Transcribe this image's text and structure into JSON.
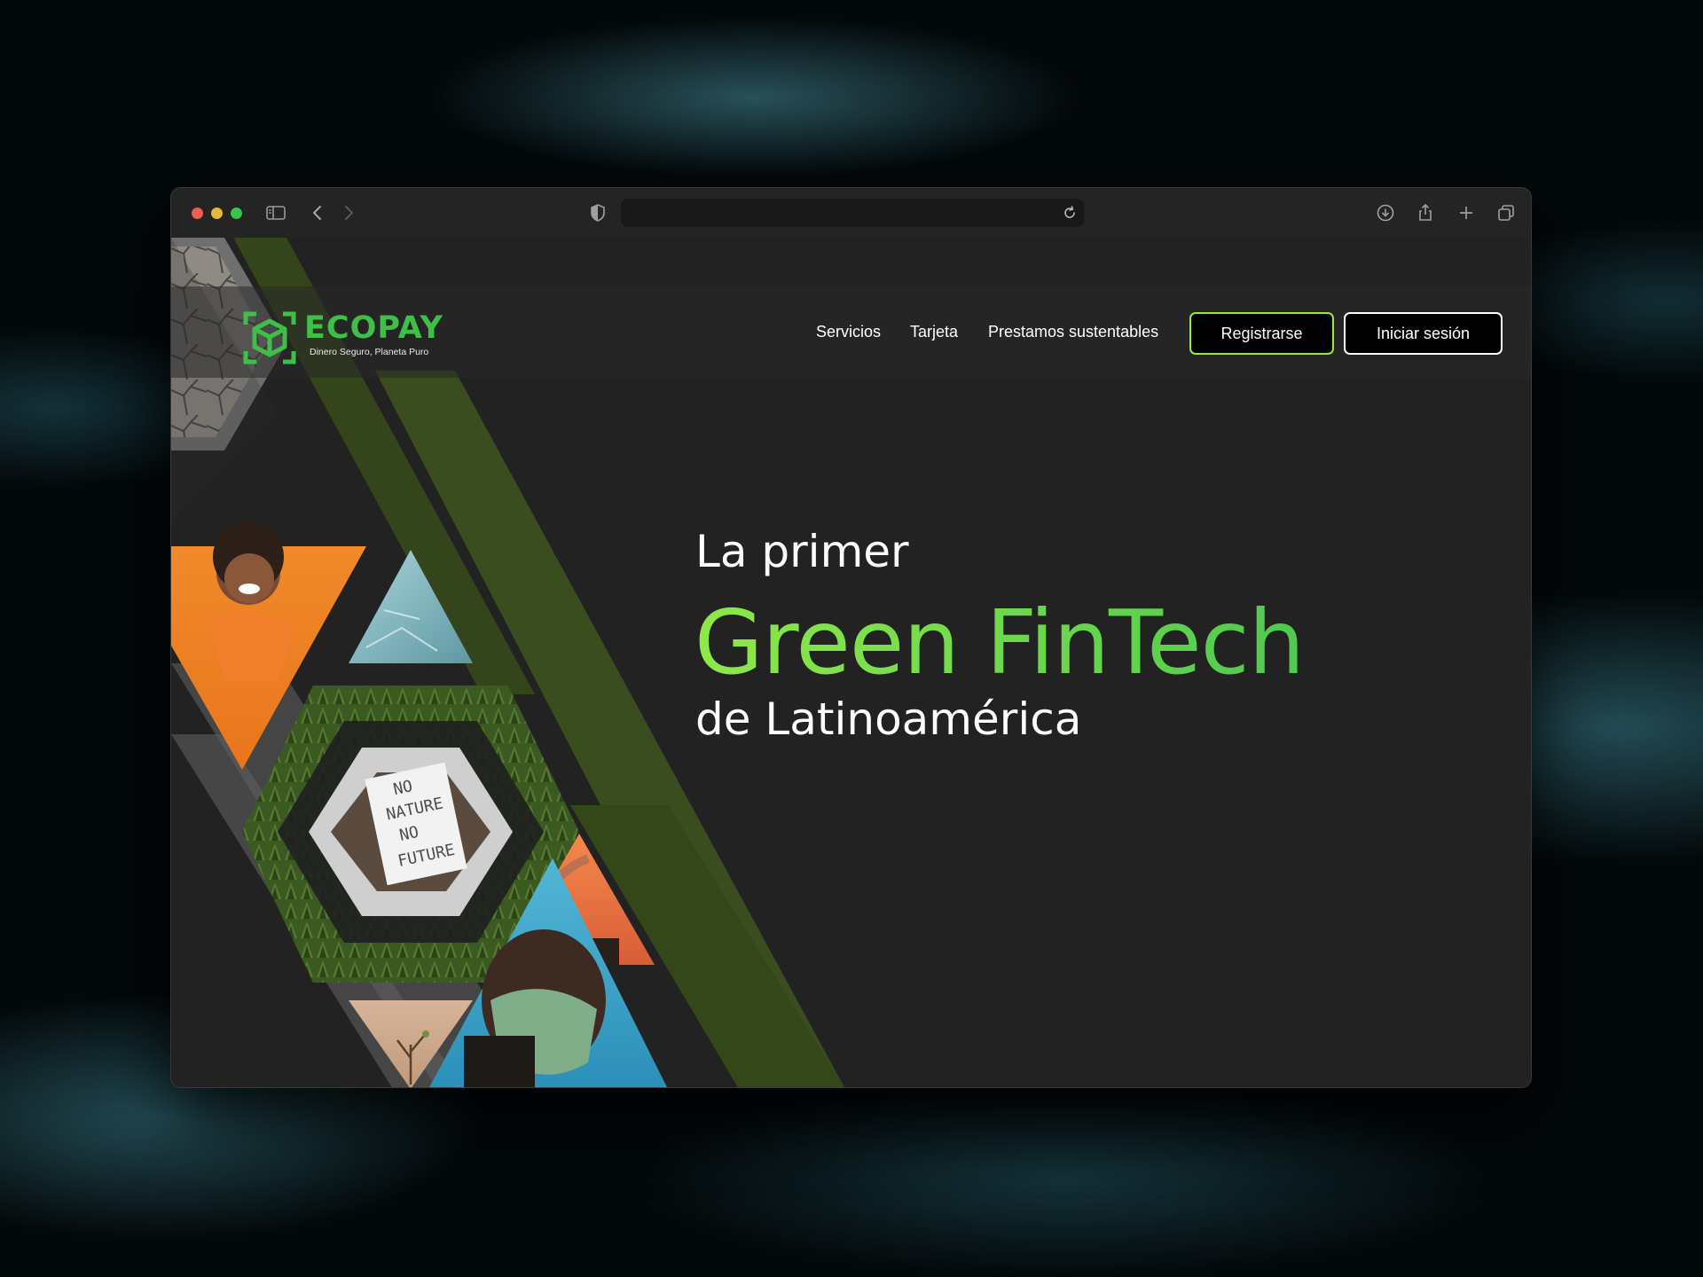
{
  "browser": {
    "controls": [
      "close",
      "minimize",
      "zoom"
    ],
    "icons": [
      "sidebar-icon",
      "back-icon",
      "forward-icon",
      "shield-icon",
      "reload-icon",
      "download-icon",
      "share-icon",
      "new-tab-icon",
      "tabs-overview-icon"
    ]
  },
  "brand": {
    "name": "ECOPAY",
    "tagline": "Dinero Seguro, Planeta Puro",
    "color": "#3fbf4a"
  },
  "nav": {
    "links": [
      "Servicios",
      "Tarjeta",
      "Prestamos sustentables"
    ],
    "register_label": "Registrarse",
    "login_label": "Iniciar sesión"
  },
  "hero": {
    "line1": "La primer",
    "line2": "Green FinTech",
    "line3": "de Latinoamérica",
    "accent": "#7be04a"
  },
  "collage": {
    "protest_sign": [
      "NO",
      "NATURE",
      "NO",
      "FUTURE"
    ]
  },
  "colors": {
    "page_bg": "#222222",
    "register_border": "#9ee843",
    "dark_green": "#3a4a1e"
  }
}
